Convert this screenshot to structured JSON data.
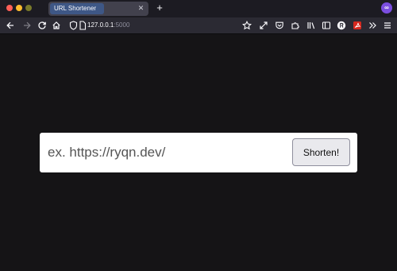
{
  "browser": {
    "tab": {
      "title": "URL Shortener",
      "close_glyph": "✕"
    },
    "new_tab_glyph": "+",
    "extension_badge_glyph": "∞",
    "url": {
      "host": "127.0.0.1",
      "port": ":5000"
    },
    "toolbar_icons": [
      "back-icon",
      "forward-icon",
      "reload-icon",
      "home-icon",
      "shield-icon",
      "page-icon",
      "bookmark-star-icon",
      "expand-icon",
      "pocket-icon",
      "extensions-icon",
      "library-icon",
      "sidebar-icon",
      "profile-icon",
      "pdf-icon",
      "overflow-icon",
      "menu-icon"
    ]
  },
  "shortener": {
    "input_placeholder": "ex. https://ryqn.dev/",
    "input_value": "",
    "button_label": "Shorten!"
  },
  "colors": {
    "page_background": "#151416",
    "tabbar_background": "#1c1b22",
    "navbar_background": "#2b2a33",
    "form_background": "#ffffff",
    "button_background": "#e9e9ed"
  }
}
